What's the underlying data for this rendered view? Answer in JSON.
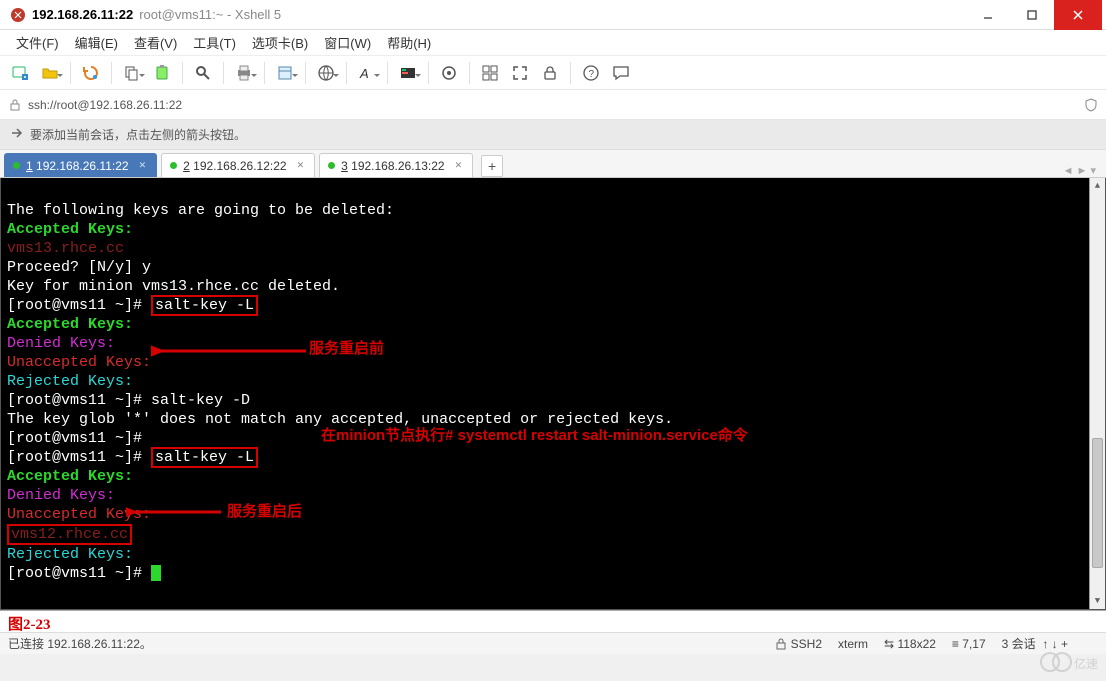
{
  "titlebar": {
    "title": "192.168.26.11:22",
    "subtitle": "root@vms11:~ - Xshell 5"
  },
  "menubar": {
    "file": "文件(F)",
    "edit": "编辑(E)",
    "view": "查看(V)",
    "tools": "工具(T)",
    "tabs": "选项卡(B)",
    "window": "窗口(W)",
    "help": "帮助(H)"
  },
  "addressbar": {
    "url": "ssh://root@192.168.26.11:22"
  },
  "hintbar": {
    "text": "要添加当前会话，点击左侧的箭头按钮。"
  },
  "tabs": {
    "t1": "192.168.26.11:22",
    "t2": "192.168.26.12:22",
    "t3": "192.168.26.13:22",
    "n1": "1",
    "n2": "2",
    "n3": "3",
    "plus": "+"
  },
  "term": {
    "l1": "The following keys are going to be deleted:",
    "l2": "Accepted Keys:",
    "l3": "vms13.rhce.cc",
    "l4": "Proceed? [N/y] y",
    "l5": "Key for minion vms13.rhce.cc deleted.",
    "l6p": "[root@vms11 ~]# ",
    "l6c": "salt-key -L",
    "l7": "Accepted Keys:",
    "l8": "Denied Keys:",
    "l9": "Unaccepted Keys:",
    "l10": "Rejected Keys:",
    "l11p": "[root@vms11 ~]# ",
    "l11c": "salt-key -D",
    "l12": "The key glob '*' does not match any accepted, unaccepted or rejected keys.",
    "l13p": "[root@vms11 ~]#",
    "l14p": "[root@vms11 ~]# ",
    "l14c": "salt-key -L",
    "l15": "Accepted Keys:",
    "l16": "Denied Keys:",
    "l17": "Unaccepted Keys:",
    "l18": "vms12.rhce.cc",
    "l19": "Rejected Keys:",
    "l20p": "[root@vms11 ~]# "
  },
  "annotations": {
    "a1": "服务重启前",
    "a2": "在minion节点执行# systemctl restart salt-minion.service命令",
    "a3": "服务重启后"
  },
  "figure": {
    "label": "图2-23"
  },
  "statusbar": {
    "conn": "已连接 192.168.26.11:22。",
    "ssh": "SSH2",
    "term": "xterm",
    "size": "118x22",
    "pos": "7,17",
    "sess": "3 会话",
    "sizeIconPrefix": "⇆",
    "posIconPrefix": "≡"
  }
}
